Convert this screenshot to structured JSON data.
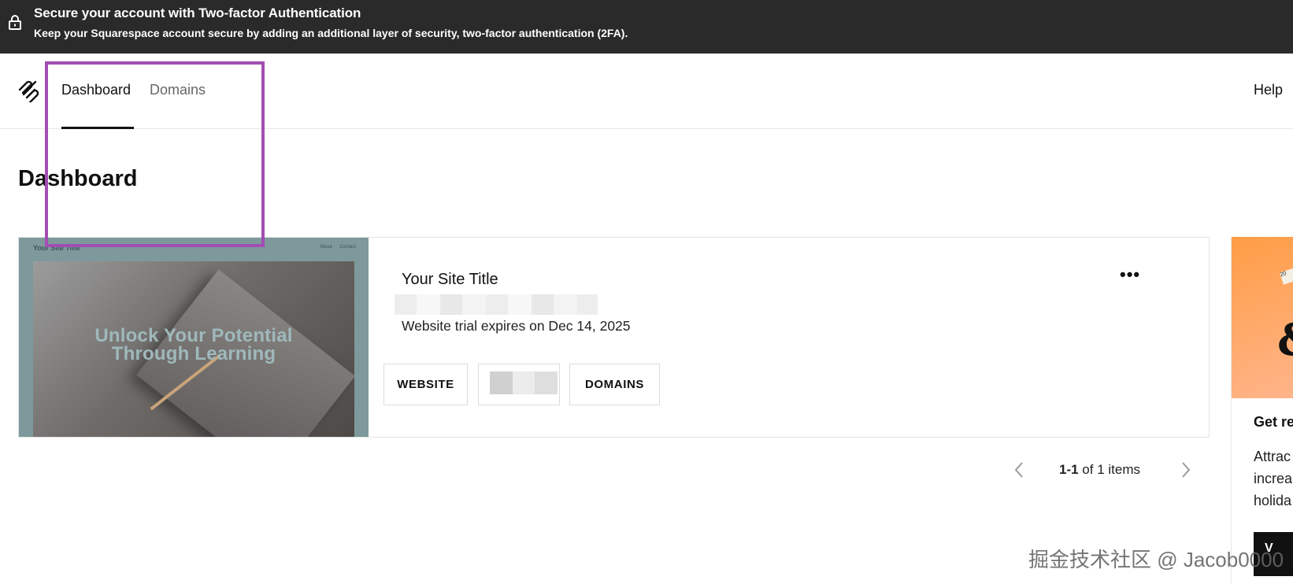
{
  "banner": {
    "title": "Secure your account with Two-factor Authentication",
    "subtitle": "Keep your Squarespace account secure by adding an additional layer of security, two-factor authentication (2FA).",
    "icon": "lock-icon"
  },
  "nav": {
    "logo": "squarespace-logo",
    "tabs": [
      {
        "label": "Dashboard",
        "active": true
      },
      {
        "label": "Domains",
        "active": false
      }
    ],
    "help_label": "Help"
  },
  "page": {
    "title": "Dashboard"
  },
  "site_card": {
    "thumbnail": {
      "site_title": "Your Site Title",
      "nav_about": "About",
      "nav_contact": "Contact",
      "headline_line1": "Unlock Your Potential",
      "headline_line2": "Through Learning"
    },
    "title": "Your Site Title",
    "trial_text": "Website trial expires on Dec 14, 2025",
    "more_label": "•••",
    "buttons": {
      "website": "WEBSITE",
      "domains": "DOMAINS"
    }
  },
  "pagination": {
    "range": "1-1",
    "suffix": " of 1 items"
  },
  "promo": {
    "title": "Get re",
    "body_line1": "Attrac",
    "body_line2": "increa",
    "body_line3": "holida",
    "button_label": "V",
    "tag_text": "20",
    "ampersand": "&"
  },
  "watermark": "掘金技术社区 @ Jacob0000",
  "colors": {
    "banner_bg": "#2a2a2a",
    "highlight": "#a24db3",
    "promo_bg": "#ff9d45"
  }
}
